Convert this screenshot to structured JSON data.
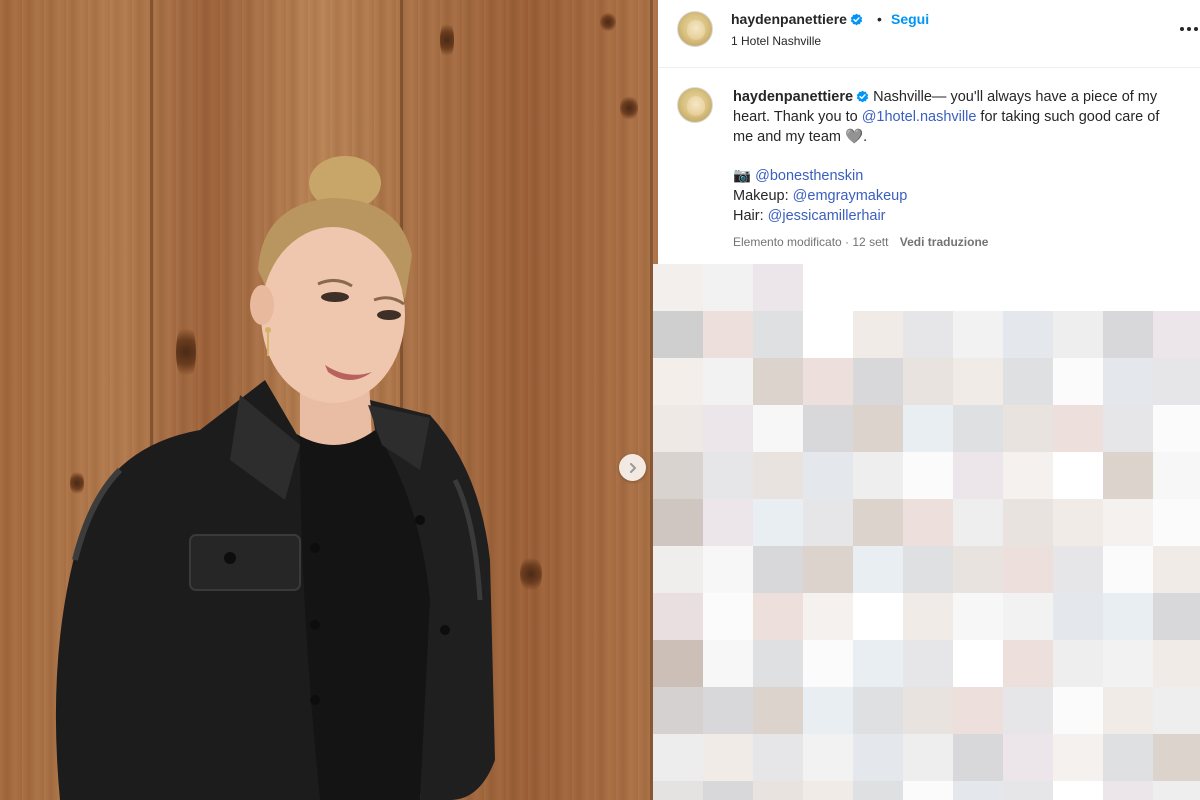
{
  "post": {
    "username": "haydenpanettiere",
    "separator": "•",
    "follow_label": "Segui",
    "location": "1 Hotel Nashville"
  },
  "caption": {
    "username": "haydenpanettiere",
    "text_part1": " Nashville— you'll always have a piece of my heart. Thank you to ",
    "mention_hotel": "@1hotel.nashville",
    "text_part2": " for taking such good care of me and my team ",
    "heart_emoji": "🩶",
    "text_end": ".",
    "camera_emoji": "📷",
    "photo_credit": "@bonesthenskin",
    "makeup_label": "Makeup: ",
    "makeup_credit": "@emgraymakeup",
    "hair_label": "Hair: ",
    "hair_credit": "@jessicamillerhair"
  },
  "meta": {
    "edited": "Elemento modificato · 12 sett",
    "translate": "Vedi traduzione"
  },
  "icons": {
    "verified": "verified-badge-icon",
    "more": "more-options-icon",
    "next": "chevron-right-icon"
  },
  "colors": {
    "link_blue": "#0095f6",
    "verified_blue": "#0095f6",
    "mention": "#3b5fbf",
    "meta_gray": "#737373"
  }
}
